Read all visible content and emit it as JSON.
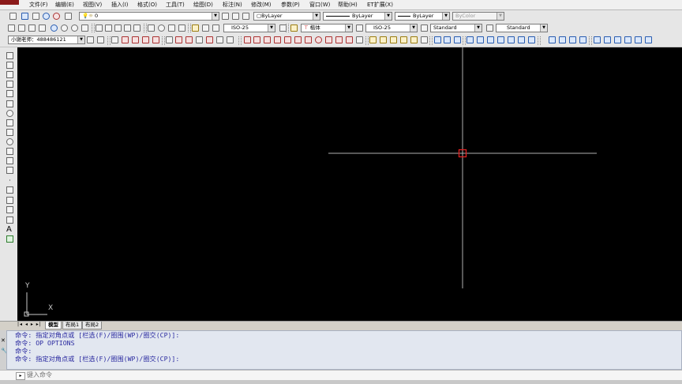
{
  "menu": [
    "文件(F)",
    "编辑(E)",
    "视图(V)",
    "插入(I)",
    "格式(O)",
    "工具(T)",
    "绘图(D)",
    "标注(N)",
    "修改(M)",
    "参数(P)",
    "窗口(W)",
    "帮助(H)",
    "ET扩展(X)"
  ],
  "layer_toolbar": {
    "layer_name": "0",
    "color": "ByLayer",
    "linetype": "ByLayer",
    "lineweight": "ByLayer",
    "plotstyle": "ByColor"
  },
  "styles_toolbar": {
    "dim_style": "ISO-25",
    "text_font": "楷体",
    "dim_style2": "ISO-25",
    "text_style": "Standard",
    "table_style": "Standard"
  },
  "workspace": {
    "name": "小谢老师：488486121"
  },
  "ucs": {
    "y_label": "Y",
    "x_label": "X"
  },
  "tabs": {
    "model": "模型",
    "layout1": "布局1",
    "layout2": "布局2"
  },
  "command_lines": [
    "命令: 指定对角点或 [栏选(F)/圈围(WP)/圈交(CP)]:",
    "命令: OP OPTIONS",
    "命令:",
    "命令: 指定对角点或 [栏选(F)/圈围(WP)/圈交(CP)]:"
  ],
  "command_input": {
    "prompt": "键入命令"
  },
  "colors": {
    "canvas": "#000000",
    "crosshair": "#b0b0b0",
    "pickbox": "#e02020",
    "command_text": "#2a2aa0"
  }
}
